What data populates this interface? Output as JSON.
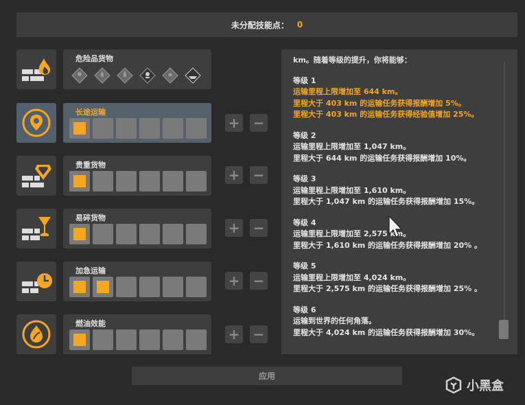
{
  "header": {
    "label": "未分配技能点：",
    "value": "0"
  },
  "skills": [
    {
      "name": "危险品货物",
      "icon": "hazard-fire-icon",
      "filled": 0,
      "total": 0,
      "selected": false,
      "hazard_icons": [
        "explosive-diamond-icon",
        "flammable-gas-diamond-icon",
        "flammable-liquid-diamond-icon",
        "toxic-diamond-icon",
        "radioactive-diamond-icon",
        "corrosive-diamond-icon"
      ]
    },
    {
      "name": "长途运输",
      "icon": "location-pin-icon",
      "filled": 1,
      "total": 6,
      "selected": true
    },
    {
      "name": "贵重货物",
      "icon": "diamond-icon",
      "filled": 1,
      "total": 6,
      "selected": false
    },
    {
      "name": "易碎货物",
      "icon": "glass-icon",
      "filled": 1,
      "total": 6,
      "selected": false
    },
    {
      "name": "加急运输",
      "icon": "clock-icon",
      "filled": 2,
      "total": 6,
      "selected": false
    },
    {
      "name": "燃油效能",
      "icon": "fuel-drop-leaf-icon",
      "filled": 1,
      "total": 6,
      "selected": false
    }
  ],
  "controls": {
    "plus": "+",
    "minus": "−"
  },
  "description": {
    "intro": "km。随着等级的提升，你将能够：",
    "levels": [
      {
        "title": "等级 1",
        "active": true,
        "lines": [
          "运输里程上限增加至 644 km。",
          "里程大于 403 km 的运输任务获得报酬增加 5%。",
          "里程大于 403 km 的运输任务获得经验值增加 25%。"
        ]
      },
      {
        "title": "等级 2",
        "active": false,
        "lines": [
          "运输里程上限增加至 1,047 km。",
          "里程大于 644 km 的运输任务获得报酬增加 10%。"
        ]
      },
      {
        "title": "等级 3",
        "active": false,
        "lines": [
          "运输里程上限增加至 1,610 km。",
          "里程大于 1,047 km 的运输任务获得报酬增加 15%。"
        ]
      },
      {
        "title": "等级 4",
        "active": false,
        "lines": [
          "运输里程上限增加至 2,575 km。",
          "里程大于 1,610 km 的运输任务获得报酬增加 20% 。"
        ]
      },
      {
        "title": "等级 5",
        "active": false,
        "lines": [
          "运输里程上限增加至 4,024 km。",
          "里程大于 2,575 km 的运输任务获得报酬增加 25% 。"
        ]
      },
      {
        "title": "等级 6",
        "active": false,
        "lines": [
          "运输到世界的任何角落。",
          "里程大于 4,024 km 的运输任务获得报酬增加 30%。"
        ]
      }
    ]
  },
  "apply_label": "应用",
  "watermark": "小黑盒",
  "colors": {
    "accent": "#f5a623",
    "panel": "#3e3e3e",
    "selected": "#56616c",
    "background": "#2a2a2a"
  }
}
